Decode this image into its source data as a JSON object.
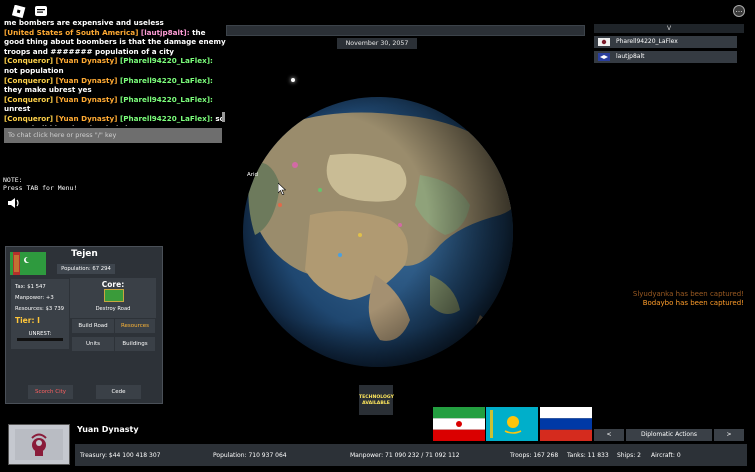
{
  "chat": {
    "messages": [
      {
        "parts": [
          {
            "text": "me bombers are expensive and useless",
            "cls": ""
          }
        ]
      },
      {
        "parts": [
          {
            "text": "[United States of South America]",
            "cls": "tag-country"
          },
          {
            "text": " [lautjp8alt]:",
            "cls": "tag-user"
          },
          {
            "text": "  the good thing about boombers is that the damage enemy troops and ####### population of a city",
            "cls": ""
          }
        ]
      },
      {
        "parts": [
          {
            "text": "[Conqueror]",
            "cls": "tag-conq"
          },
          {
            "text": " [Yuan Dynasty]",
            "cls": "tag-yuan"
          },
          {
            "text": " [Pharell94220_LaFlex]:",
            "cls": "tag-player"
          },
          {
            "text": "  not population",
            "cls": ""
          }
        ]
      },
      {
        "parts": [
          {
            "text": "[Conqueror]",
            "cls": "tag-conq"
          },
          {
            "text": " [Yuan Dynasty]",
            "cls": "tag-yuan"
          },
          {
            "text": " [Pharell94220_LaFlex]:",
            "cls": "tag-player"
          },
          {
            "text": "  they make ubrest yes",
            "cls": ""
          }
        ]
      },
      {
        "parts": [
          {
            "text": "[Conqueror]",
            "cls": "tag-conq"
          },
          {
            "text": " [Yuan Dynasty]",
            "cls": "tag-yuan"
          },
          {
            "text": " [Pharell94220_LaFlex]:",
            "cls": "tag-player"
          },
          {
            "text": "  unrest",
            "cls": ""
          }
        ]
      },
      {
        "parts": [
          {
            "text": "[Conqueror]",
            "cls": "tag-conq"
          },
          {
            "text": " [Yuan Dynasty]",
            "cls": "tag-yuan"
          },
          {
            "text": " [Pharell94220_LaFlex]:",
            "cls": "tag-player"
          },
          {
            "text": "  so u cant build in a bombarded city",
            "cls": ""
          }
        ]
      }
    ],
    "input_placeholder": "To chat click here or press \"/\" key"
  },
  "note_text": "NOTE:\nPress TAB for Menu!",
  "top": {
    "date": "November 30, 2057",
    "menu_dots": "…"
  },
  "player_list": {
    "header": "V",
    "players": [
      {
        "name": "Pharell94220_LaFlex"
      },
      {
        "name": "lautjp8alt"
      }
    ]
  },
  "globe": {
    "label": "Arid"
  },
  "notifications": [
    {
      "text": "Slyudyanka has been captured!"
    },
    {
      "text": "Bodaybo has been captured!"
    }
  ],
  "city": {
    "name": "Tejen",
    "population": "Population: 67 294",
    "tax": "Tax: $1 547",
    "manpower": "Manpower: +3",
    "resources": "Resources: $3 739",
    "tier": "Tier: I",
    "unrest_label": "UNREST:",
    "core_label": "Core:",
    "destroy_road": "Destroy Road",
    "build_road": "Build Road",
    "resources_btn": "Resources",
    "units": "Units",
    "buildings": "Buildings",
    "scorch": "Scorch City",
    "cede": "Cede"
  },
  "technology": {
    "line1": "TECHNOLOGY",
    "line2": "AVAILABLE"
  },
  "nation": {
    "name": "Yuan Dynasty",
    "treasury": "Treasury:  $44 100 418 307",
    "population": "Population:  710 937 064",
    "manpower": "Manpower:  71 090 232  /  71 092 112",
    "troops": "Troops: 167 268",
    "tanks": "Tanks: 11 833",
    "ships": "Ships: 2",
    "aircraft": "Aircraft: 0"
  },
  "diplomacy": {
    "prev": "<",
    "actions": "Diplomatic Actions",
    "next": ">",
    "flags": [
      "iran-flag",
      "kazakhstan-flag",
      "russia-flag"
    ]
  }
}
